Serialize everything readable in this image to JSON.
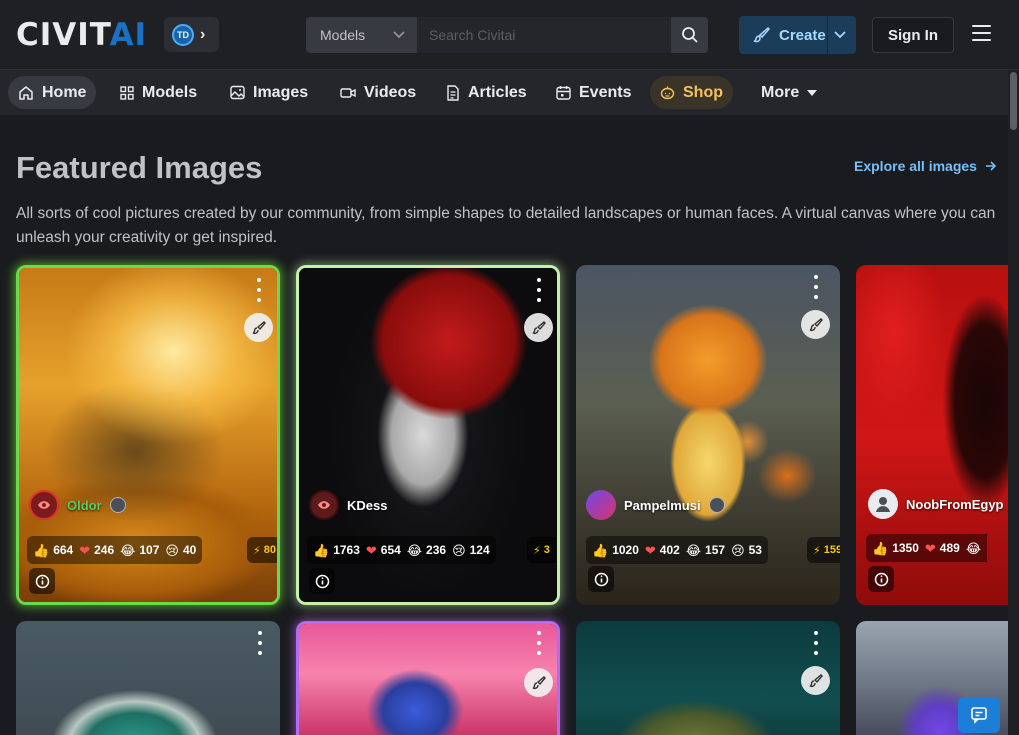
{
  "header": {
    "logo_part1": "CIVIT",
    "logo_part2": "AI",
    "domain_badge": "TD",
    "search": {
      "type_value": "Models",
      "placeholder": "Search Civitai",
      "shortcut": "/"
    },
    "create_label": "Create",
    "signin_label": "Sign In"
  },
  "nav": {
    "items": [
      {
        "label": "Home",
        "icon": "home-icon"
      },
      {
        "label": "Models",
        "icon": "grid-icon"
      },
      {
        "label": "Images",
        "icon": "photo-icon"
      },
      {
        "label": "Videos",
        "icon": "video-icon"
      },
      {
        "label": "Articles",
        "icon": "file-text-icon"
      },
      {
        "label": "Events",
        "icon": "calendar-icon"
      },
      {
        "label": "Shop",
        "icon": "pumpkin-icon"
      },
      {
        "label": "More",
        "icon": "caret-down-icon"
      }
    ]
  },
  "featured": {
    "title": "Featured Images",
    "explore_label": "Explore all images",
    "description": "All sorts of cool pictures created by our community, from simple shapes to detailed landscapes or human faces. A virtual canvas where you can unleash your creativity or get inspired."
  },
  "cards": [
    {
      "username": "Oldor",
      "likes": "664",
      "hearts": "246",
      "laughs": "107",
      "cries": "40",
      "buzz": "80"
    },
    {
      "username": "KDess",
      "likes": "1763",
      "hearts": "654",
      "laughs": "236",
      "cries": "124",
      "buzz": "3"
    },
    {
      "username": "Pampelmusi",
      "likes": "1020",
      "hearts": "402",
      "laughs": "157",
      "cries": "53",
      "buzz": "159"
    },
    {
      "username": "NoobFromEgyp",
      "likes": "1350",
      "hearts": "489"
    }
  ],
  "colors": {
    "accent": "#1971c2",
    "create_bg": "#1c3d5a",
    "link": "#74c0fc",
    "shop": "#f6c25b"
  }
}
